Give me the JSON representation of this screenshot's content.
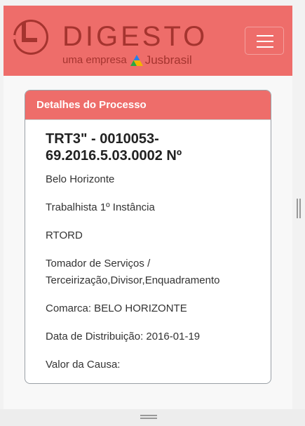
{
  "brand": {
    "wordmark": "DIGESTO",
    "subtitle_prefix": "uma empresa",
    "subtitle_brand": "Jusbrasil",
    "color": "#a5342f",
    "accent": "#ee6d6a"
  },
  "navbar": {
    "menu_icon": "hamburger-menu-icon"
  },
  "card": {
    "header": "Detalhes do Processo",
    "title": "TRT3\" - 0010053-69.2016.5.03.0002 Nº",
    "fields": [
      "Belo Horizonte",
      "Trabalhista 1º Instância",
      "RTORD",
      "Tomador de Serviços / Terceirização,Divisor,Enquadramento",
      "Comarca: BELO HORIZONTE",
      "Data de Distribuição: 2016-01-19",
      "Valor da Causa:"
    ]
  }
}
